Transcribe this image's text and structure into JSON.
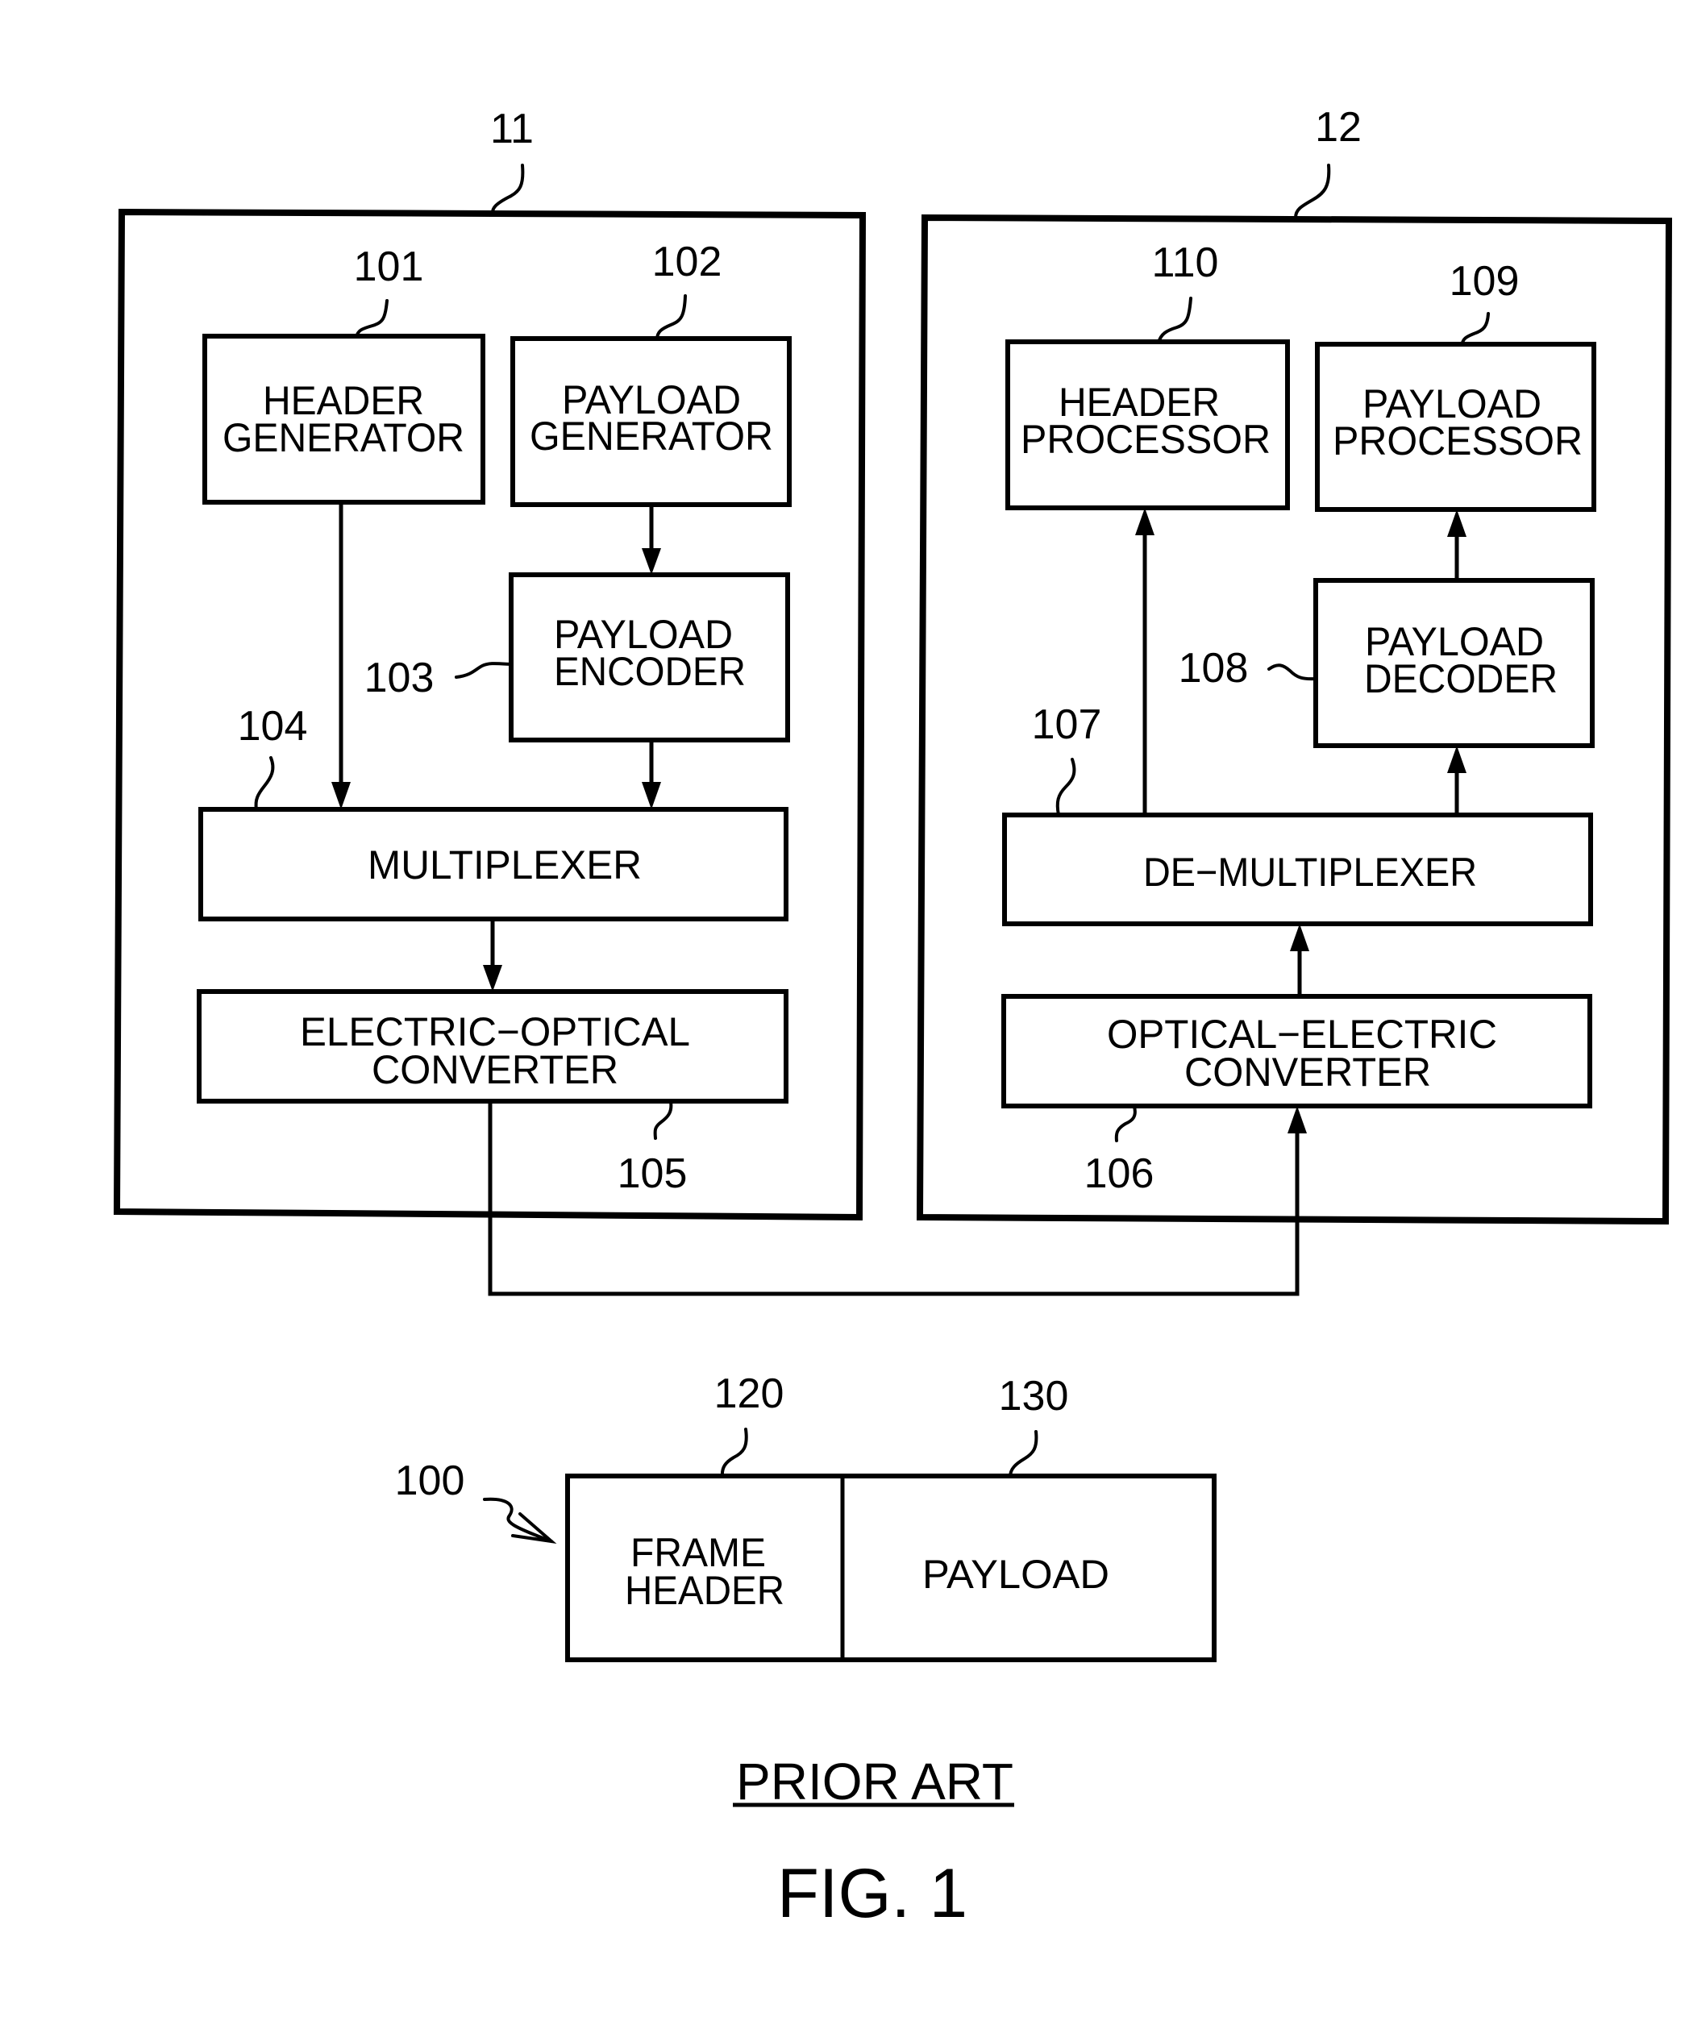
{
  "figure": {
    "caption_note": "PRIOR ART",
    "caption": "FIG. 1"
  },
  "transmitter": {
    "ref": "11",
    "blocks": {
      "header_generator": {
        "ref": "101",
        "lines": [
          "HEADER",
          "GENERATOR"
        ]
      },
      "payload_generator": {
        "ref": "102",
        "lines": [
          "PAYLOAD",
          "GENERATOR"
        ]
      },
      "payload_encoder": {
        "ref": "103",
        "lines": [
          "PAYLOAD",
          "ENCODER"
        ]
      },
      "multiplexer": {
        "ref": "104",
        "lines": [
          "MULTIPLEXER"
        ]
      },
      "eo_converter": {
        "ref": "105",
        "lines": [
          "ELECTRIC−OPTICAL",
          "CONVERTER"
        ]
      }
    }
  },
  "receiver": {
    "ref": "12",
    "blocks": {
      "oe_converter": {
        "ref": "106",
        "lines": [
          "OPTICAL−ELECTRIC",
          "CONVERTER"
        ]
      },
      "demultiplexer": {
        "ref": "107",
        "lines": [
          "DE−MULTIPLEXER"
        ]
      },
      "payload_decoder": {
        "ref": "108",
        "lines": [
          "PAYLOAD",
          "DECODER"
        ]
      },
      "payload_processor": {
        "ref": "109",
        "lines": [
          "PAYLOAD",
          "PROCESSOR"
        ]
      },
      "header_processor": {
        "ref": "110",
        "lines": [
          "HEADER",
          "PROCESSOR"
        ]
      }
    }
  },
  "frame": {
    "ref": "100",
    "fields": {
      "frame_header": {
        "ref": "120",
        "lines": [
          "FRAME",
          "HEADER"
        ]
      },
      "payload": {
        "ref": "130",
        "lines": [
          "PAYLOAD"
        ]
      }
    }
  },
  "connections": [
    {
      "from": "header_generator",
      "to": "multiplexer"
    },
    {
      "from": "payload_generator",
      "to": "payload_encoder"
    },
    {
      "from": "payload_encoder",
      "to": "multiplexer"
    },
    {
      "from": "multiplexer",
      "to": "eo_converter"
    },
    {
      "from": "eo_converter",
      "to": "oe_converter"
    },
    {
      "from": "oe_converter",
      "to": "demultiplexer"
    },
    {
      "from": "demultiplexer",
      "to": "header_processor"
    },
    {
      "from": "demultiplexer",
      "to": "payload_decoder"
    },
    {
      "from": "payload_decoder",
      "to": "payload_processor"
    }
  ]
}
